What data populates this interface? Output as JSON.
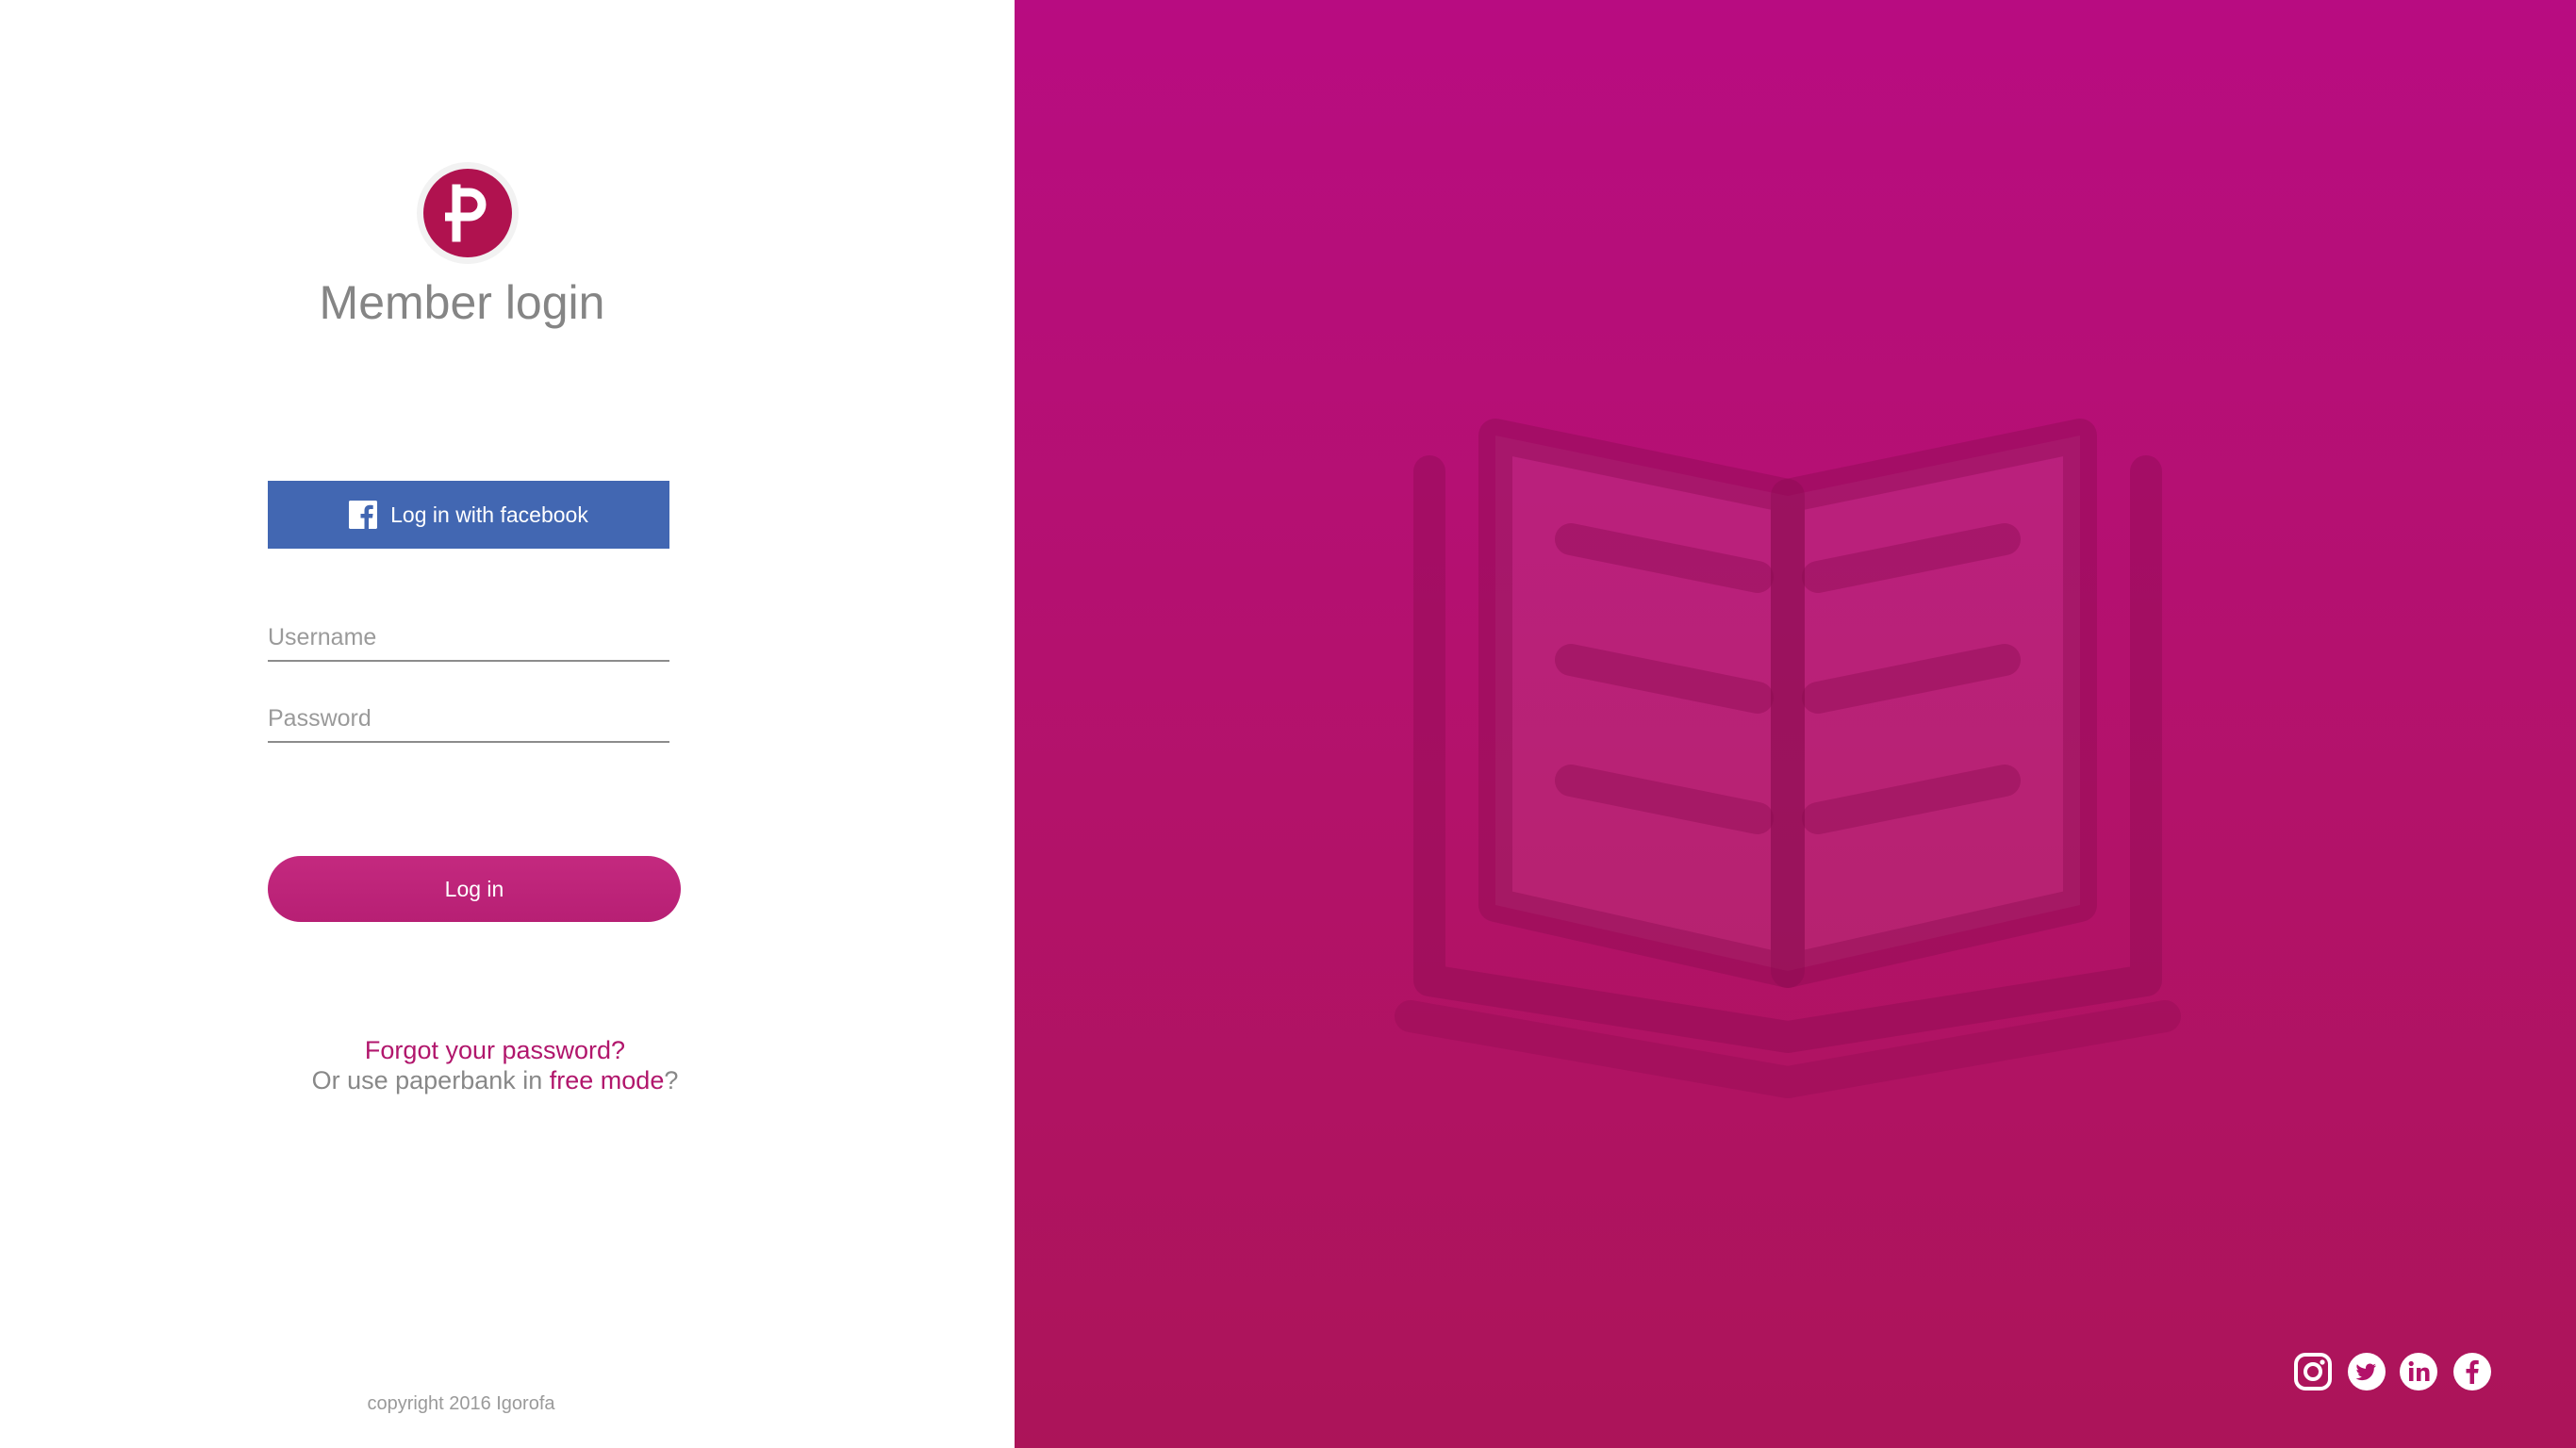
{
  "brand": {
    "logo_letter": "P",
    "logo_color": "#b0124f"
  },
  "login": {
    "title": "Member login",
    "facebook_button_label": "Log in with facebook",
    "username_placeholder": "Username",
    "password_placeholder": "Password",
    "login_button_label": "Log in",
    "forgot_password_link": "Forgot your password?",
    "free_mode_prefix": "Or use paperbank in ",
    "free_mode_link": "free mode",
    "free_mode_suffix": "?"
  },
  "footer": {
    "copyright": "copyright 2016 Igorofa"
  },
  "hero": {
    "illustration": "open-book-icon",
    "background_colors": [
      "#b80c81",
      "#ac1459"
    ]
  },
  "social_icons": [
    "instagram-icon",
    "twitter-icon",
    "linkedin-icon",
    "facebook-icon"
  ],
  "colors": {
    "accent": "#b1166c",
    "facebook": "#4267b2",
    "text_grey": "#888888"
  }
}
